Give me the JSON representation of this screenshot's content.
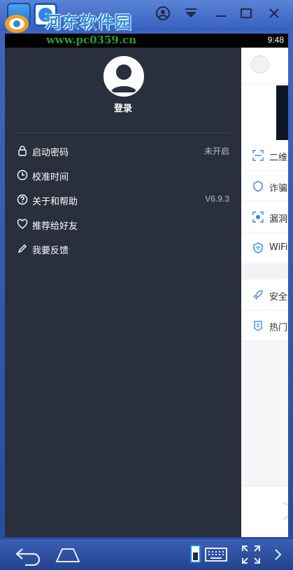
{
  "watermark": {
    "title": "河东软件园",
    "url": "www.pc0359.cn"
  },
  "status": {
    "time": "9:48"
  },
  "drawer": {
    "login_label": "登录",
    "items": [
      {
        "label": "启动密码",
        "value": "未开启",
        "icon": "lock-icon"
      },
      {
        "label": "校准时间",
        "value": "",
        "icon": "clock-icon"
      },
      {
        "label": "关于和帮助",
        "value": "V6.9.3",
        "icon": "help-icon"
      },
      {
        "label": "推荐给好友",
        "value": "",
        "icon": "heart-icon"
      },
      {
        "label": "我要反馈",
        "value": "",
        "icon": "pencil-icon"
      }
    ]
  },
  "content": {
    "rows_group1": [
      {
        "label": "二维",
        "icon": "qr-scan-icon"
      },
      {
        "label": "诈骗",
        "icon": "fraud-icon"
      },
      {
        "label": "漏洞",
        "icon": "bug-icon"
      },
      {
        "label": "WiFi",
        "icon": "wifi-shield-icon"
      }
    ],
    "rows_group2": [
      {
        "label": "安全",
        "icon": "rocket-icon"
      },
      {
        "label": "热门",
        "icon": "document-icon"
      }
    ]
  },
  "colors": {
    "drawer_bg": "#2a2f3e",
    "accent": "#2f86e6",
    "emulator_bar": "#3560bd"
  }
}
